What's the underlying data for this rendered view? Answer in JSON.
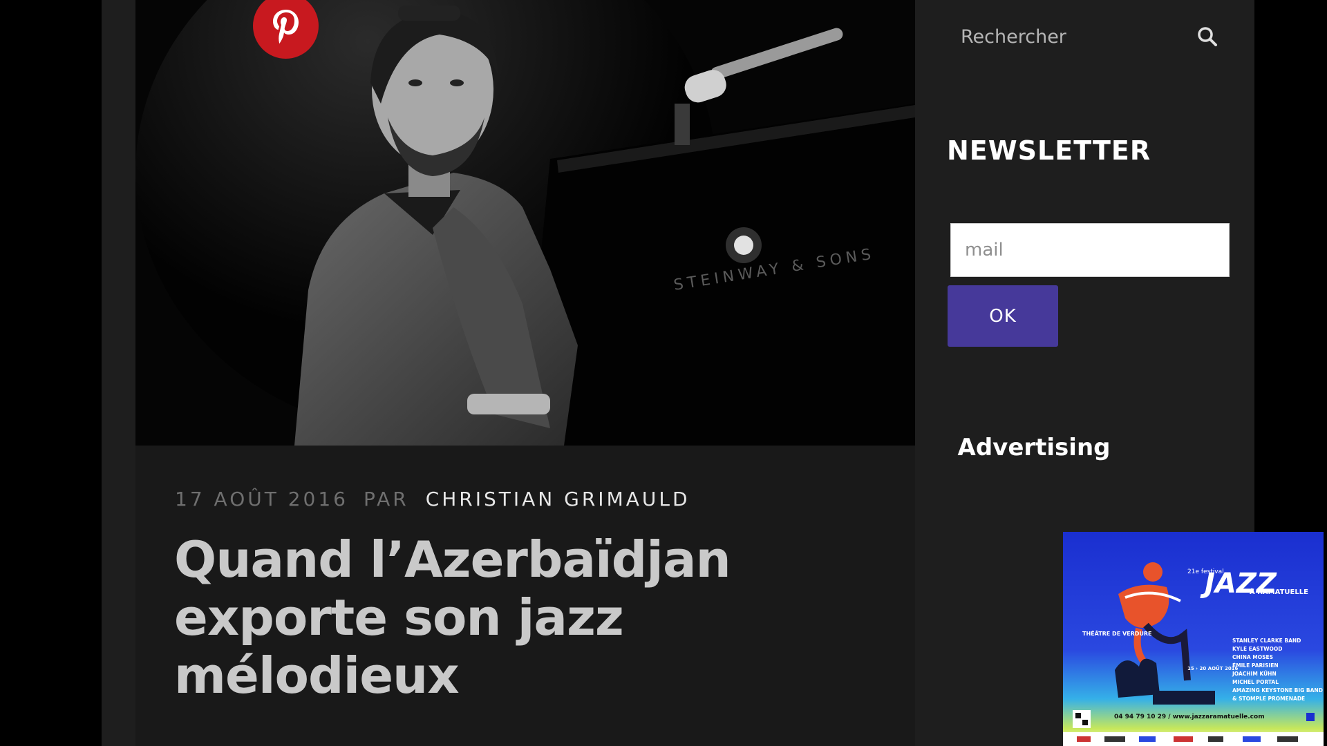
{
  "share": {
    "pinterest_icon": "pinterest-icon",
    "color": "#c8191f"
  },
  "hero_image": {
    "description_icon": "photo-pianist",
    "piano_brand": "STEINWAY & SONS"
  },
  "article": {
    "date": "17 AOÛT 2016",
    "by": "PAR",
    "author": "CHRISTIAN GRIMAULD",
    "title": "Quand l’Azerbaïdjan exporte son jazz mélodieux"
  },
  "sidebar": {
    "search": {
      "placeholder": "Rechercher",
      "icon": "search-icon"
    },
    "newsletter": {
      "title": "NEWSLETTER",
      "email_placeholder": "mail",
      "ok_label": "OK",
      "button_color": "#46399a"
    },
    "advertising": {
      "title": "Advertising",
      "banner": {
        "edition": "21e festival",
        "logo_word": "JAZZ",
        "location": "À RAMATUELLE",
        "venue": "THÉÂTRE DE VERDURE",
        "dates": "15 › 20 AOÛT 2016",
        "lineup": [
          "STANLEY CLARKE BAND",
          "KYLE EASTWOOD",
          "CHINA MOSES",
          "ÉMILE PARISIEN",
          "JOACHIM KÜHN",
          "MICHEL PORTAL",
          "AMAZING KEYSTONE BIG BAND",
          "& STOMPLE PROMENADE"
        ],
        "contact": "04 94 79 10 29 / www.jazzaramatuelle.com"
      }
    }
  }
}
